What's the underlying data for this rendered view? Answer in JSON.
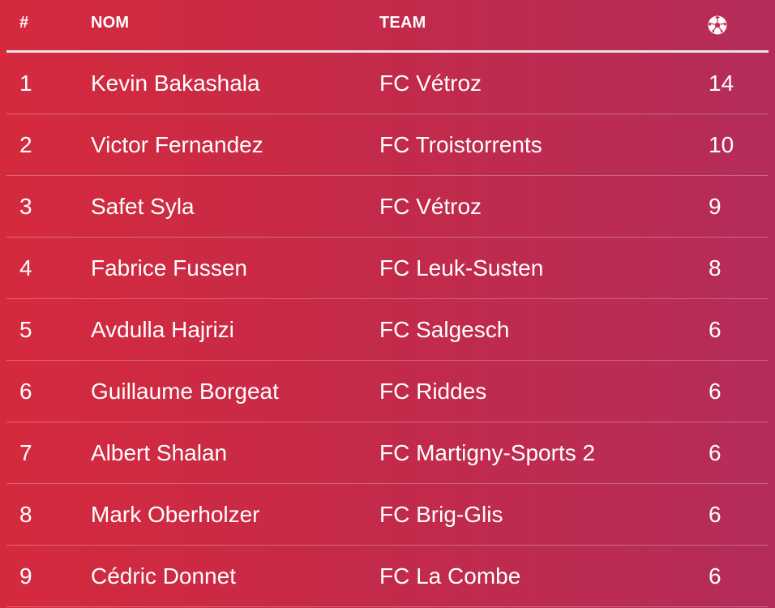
{
  "header": {
    "rank": "#",
    "name": "NOM",
    "team": "TEAM",
    "goals_icon": "soccer-ball-icon"
  },
  "rows": [
    {
      "rank": "1",
      "name": "Kevin Bakashala",
      "team": "FC Vétroz",
      "goals": "14"
    },
    {
      "rank": "2",
      "name": "Victor Fernandez",
      "team": "FC Troistorrents",
      "goals": "10"
    },
    {
      "rank": "3",
      "name": "Safet Syla",
      "team": "FC Vétroz",
      "goals": "9"
    },
    {
      "rank": "4",
      "name": "Fabrice Fussen",
      "team": "FC Leuk-Susten",
      "goals": "8"
    },
    {
      "rank": "5",
      "name": "Avdulla Hajrizi",
      "team": "FC Salgesch",
      "goals": "6"
    },
    {
      "rank": "6",
      "name": "Guillaume Borgeat",
      "team": "FC Riddes",
      "goals": "6"
    },
    {
      "rank": "7",
      "name": "Albert Shalan",
      "team": "FC Martigny-Sports 2",
      "goals": "6"
    },
    {
      "rank": "8",
      "name": "Mark Oberholzer",
      "team": "FC Brig-Glis",
      "goals": "6"
    },
    {
      "rank": "9",
      "name": "Cédric Donnet",
      "team": "FC La Combe",
      "goals": "6"
    }
  ],
  "colors": {
    "background_start": "#d52a3e",
    "background_end": "#b32d5a",
    "text": "#ffffff",
    "header_rule": "#e9e2e4"
  }
}
